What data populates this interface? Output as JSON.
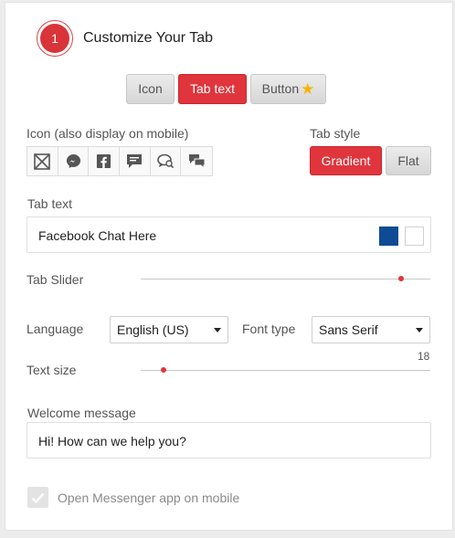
{
  "header": {
    "step_number": "1",
    "title": "Customize Your Tab"
  },
  "mode_tabs": [
    {
      "label": "Icon",
      "active": false
    },
    {
      "label": "Tab text",
      "active": true
    },
    {
      "label": "Button",
      "active": false,
      "icon": "star-icon"
    }
  ],
  "icon_section": {
    "label": "Icon (also display on mobile)",
    "icons": [
      "no-icon",
      "messenger-icon",
      "facebook-icon",
      "chat-bubble-icon",
      "chat-search-icon",
      "chat-bubbles-icon"
    ]
  },
  "tab_style": {
    "label": "Tab style",
    "options": [
      {
        "label": "Gradient",
        "active": true
      },
      {
        "label": "Flat",
        "active": false
      }
    ]
  },
  "tab_text": {
    "label": "Tab text",
    "value": "Facebook Chat Here",
    "colors": {
      "background": "#0d4b94",
      "text": "#ffffff"
    }
  },
  "tab_slider": {
    "label": "Tab Slider",
    "level": 0.9
  },
  "language": {
    "label": "Language",
    "selected": "English (US)"
  },
  "font_type": {
    "label": "Font type",
    "selected": "Sans Serif"
  },
  "text_size": {
    "label": "Text size",
    "value": "18",
    "level": 0.08
  },
  "welcome": {
    "label": "Welcome message",
    "value": "Hi! How can we help you?"
  },
  "messenger_option": {
    "label": "Open Messenger app on mobile",
    "checked": true
  },
  "colors": {
    "accent": "#e0353c"
  }
}
